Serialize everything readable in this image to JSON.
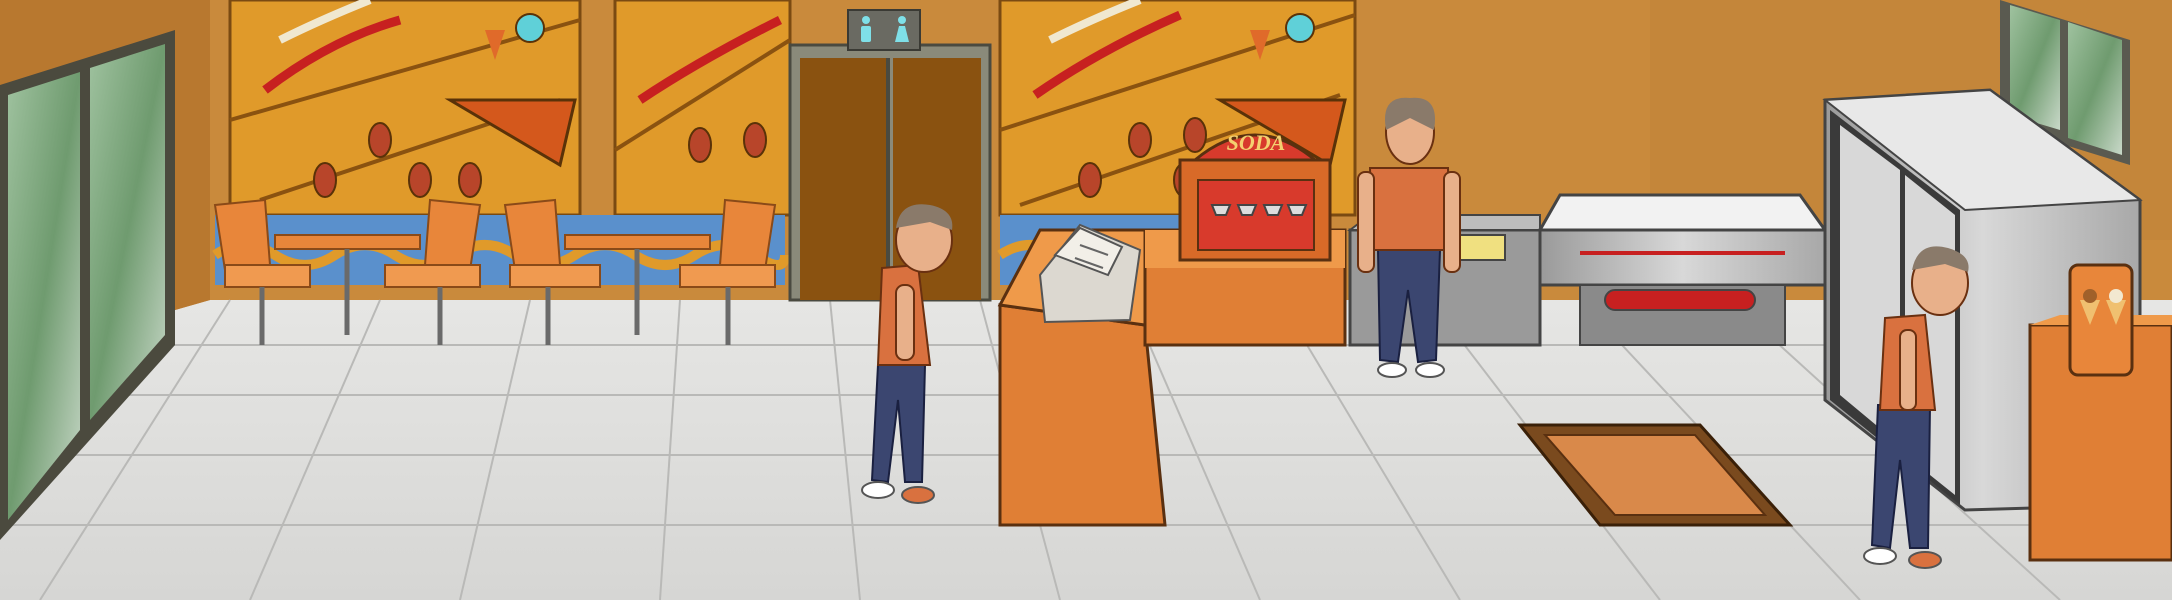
{
  "scene": {
    "name": "fast-food-restaurant-interior",
    "soda_sign": "SODA",
    "restroom_sign_icons": [
      "man-icon",
      "woman-icon"
    ]
  },
  "characters": [
    {
      "id": "worker-center",
      "pose": "side-view"
    },
    {
      "id": "worker-back",
      "pose": "back-view"
    },
    {
      "id": "worker-right",
      "pose": "side-view"
    }
  ],
  "colors": {
    "wall": "#c98a3c",
    "mural": "#e09a2a",
    "counter": "#e07f35",
    "floor": "#e4e4e2",
    "steel": "#bfbfbf",
    "shirt": "#d9713f",
    "jeans": "#3b4670",
    "soda_red": "#d83a2c",
    "window_green": "#6f9b6f"
  }
}
